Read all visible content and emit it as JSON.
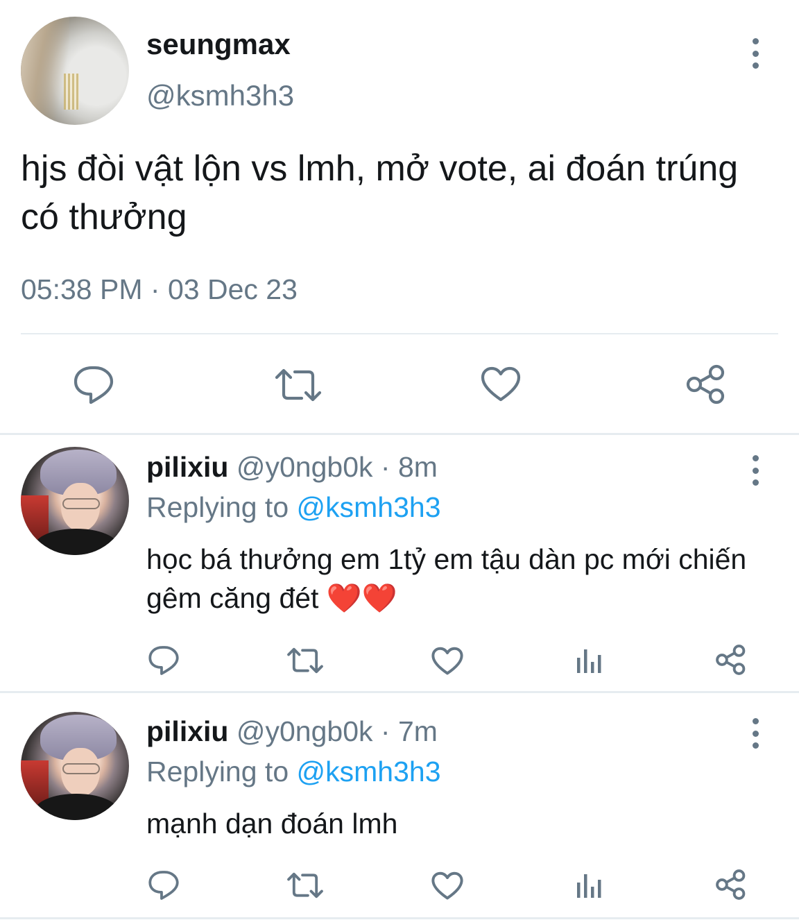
{
  "tweet": {
    "author_name": "seungmax",
    "author_handle": "@ksmh3h3",
    "text": "hjs đòi vật lộn vs lmh, mở vote, ai đoán trúng có thưởng",
    "time": "05:38 PM",
    "separator": "·",
    "date": "03 Dec 23",
    "actions": [
      "reply-icon",
      "retweet-icon",
      "like-icon",
      "share-icon"
    ]
  },
  "replies": [
    {
      "name": "pilixiu",
      "handle": "@y0ngb0k",
      "separator": "·",
      "time": "8m",
      "replying_label": "Replying to",
      "replying_to": "@ksmh3h3",
      "text": "học bá thưởng em 1tỷ em tậu dàn pc mới chiến gêm căng đét ❤️❤️"
    },
    {
      "name": "pilixiu",
      "handle": "@y0ngb0k",
      "separator": "·",
      "time": "7m",
      "replying_label": "Replying to",
      "replying_to": "@ksmh3h3",
      "text": "mạnh dạn đoán lmh"
    }
  ],
  "colors": {
    "text": "#14171a",
    "secondary": "#657786",
    "link": "#1da1f2",
    "divider": "#e6ecf0"
  }
}
